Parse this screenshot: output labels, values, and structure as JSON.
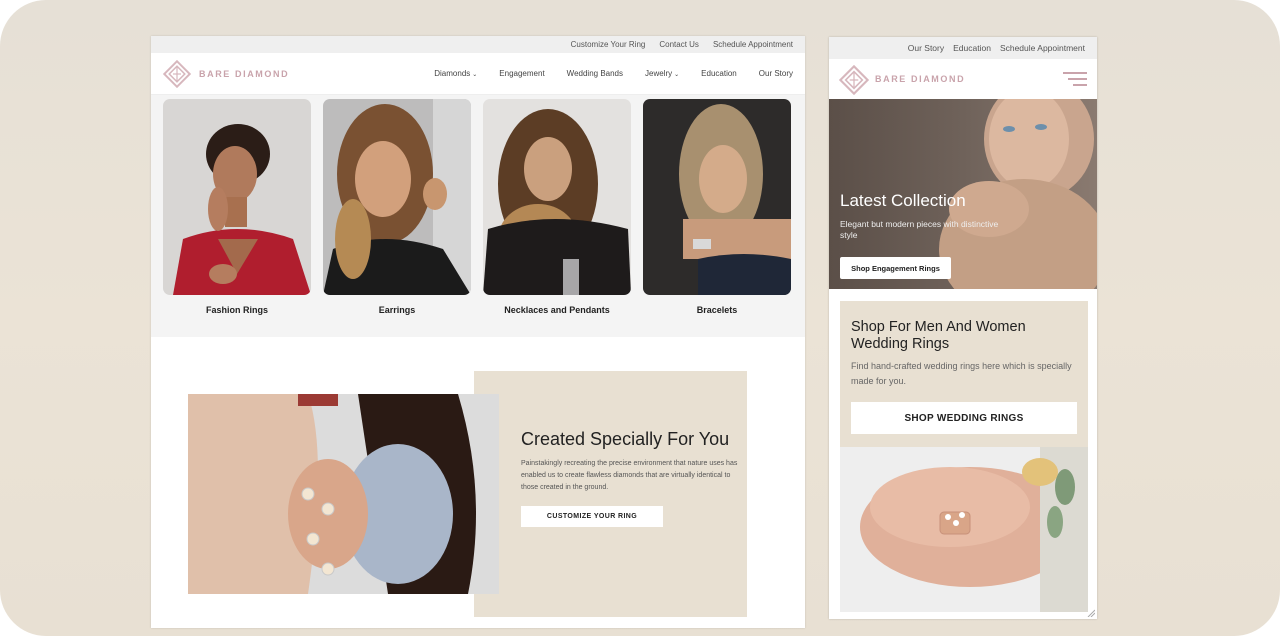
{
  "desktop": {
    "topbar": {
      "links": [
        "Customize Your Ring",
        "Contact Us",
        "Schedule Appointment"
      ]
    },
    "brand": {
      "name": "BARE DIAMOND",
      "color": "#c9a3ab"
    },
    "nav": {
      "items": [
        {
          "label": "Diamonds",
          "has_dropdown": true
        },
        {
          "label": "Engagement",
          "has_dropdown": false
        },
        {
          "label": "Wedding Bands",
          "has_dropdown": false
        },
        {
          "label": "Jewelry",
          "has_dropdown": true
        },
        {
          "label": "Education",
          "has_dropdown": false
        },
        {
          "label": "Our Story",
          "has_dropdown": false
        }
      ],
      "dropdown_icon": "chevron-down-icon"
    },
    "categories": [
      {
        "label": "Fashion Rings",
        "image": "woman in red top smiling with rings"
      },
      {
        "label": "Earrings",
        "image": "woman with hoop earrings"
      },
      {
        "label": "Necklaces and Pendants",
        "image": "woman with necklace holding glass"
      },
      {
        "label": "Bracelets",
        "image": "woman with bracelet in dark dress"
      }
    ],
    "feature": {
      "title": "Created Specially For You",
      "body": "Painstakingly recreating the precise environment that nature uses has enabled us to create flawless diamonds that are virtually identical to those created in the ground.",
      "button": "CUSTOMIZE YOUR RING",
      "image": "hand with multiple diamond rings on shoulder",
      "panel_color": "#e8e0d2"
    }
  },
  "mobile": {
    "topbar": {
      "links": [
        "Our Story",
        "Education",
        "Schedule Appointment"
      ]
    },
    "brand": {
      "name": "BARE DIAMOND"
    },
    "menu_icon": "hamburger-icon",
    "hero": {
      "title": "Latest Collection",
      "subtitle": "Elegant but modern pieces with distinctive style",
      "button": "Shop Engagement Rings",
      "image": "woman with ring posing"
    },
    "promo": {
      "title": "Shop For Men And Women Wedding Rings",
      "body": "Find hand-crafted wedding rings here which is specially made for you.",
      "button": "SHOP WEDDING RINGS",
      "image": "hand with stacked rose gold rings"
    }
  }
}
